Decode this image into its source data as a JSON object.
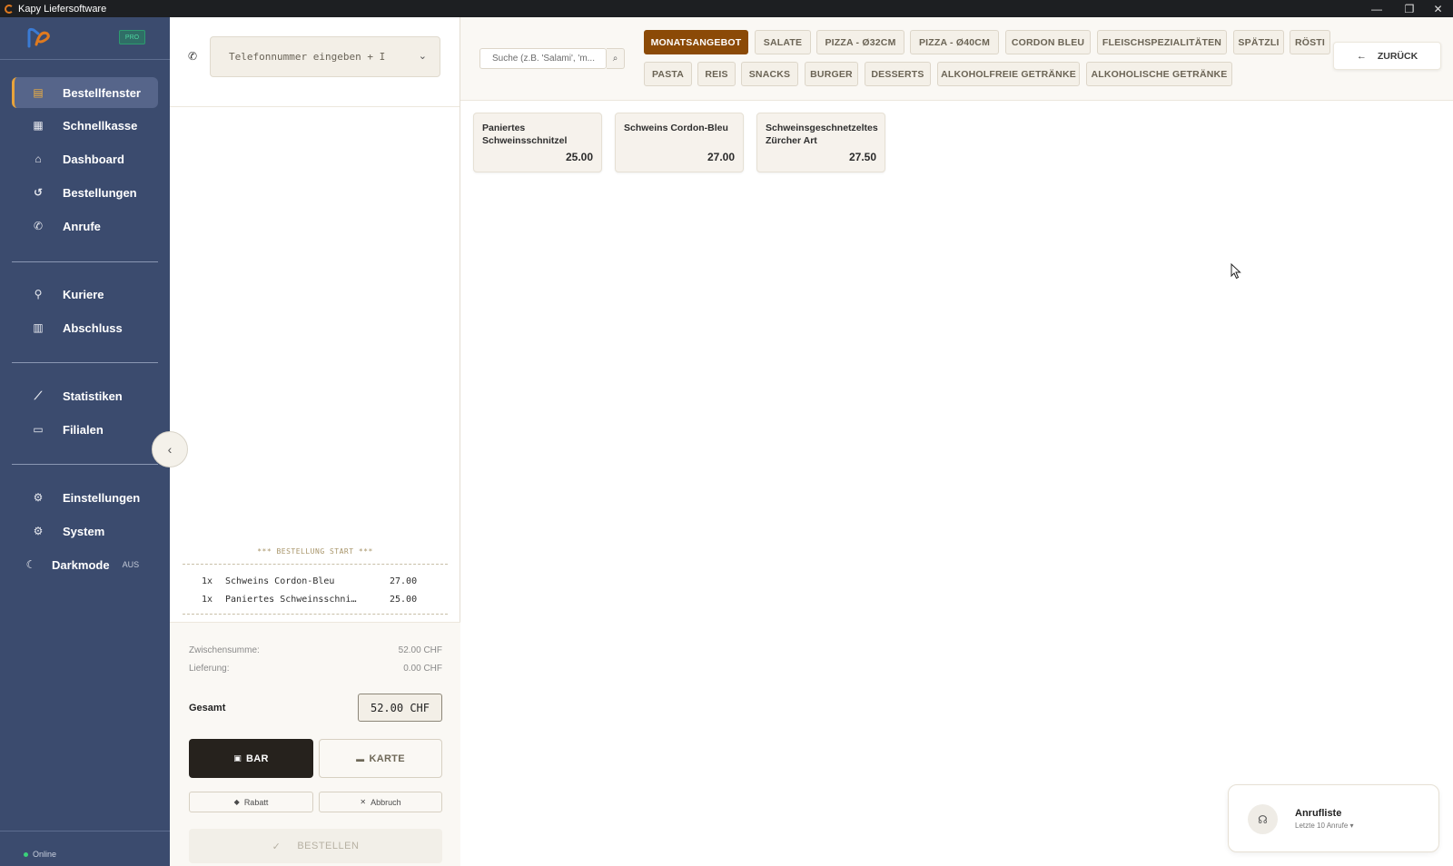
{
  "window": {
    "title": "Kapy Liefersoftware",
    "controls": {
      "minimize": "—",
      "maximize": "❐",
      "close": "✕"
    }
  },
  "sidebar": {
    "badge": "PRO",
    "items": [
      {
        "label": "Bestellfenster",
        "icon": "receipt-icon"
      },
      {
        "label": "Schnellkasse",
        "icon": "register-icon"
      },
      {
        "label": "Dashboard",
        "icon": "home-icon"
      },
      {
        "label": "Bestellungen",
        "icon": "history-icon"
      },
      {
        "label": "Anrufe",
        "icon": "phone-icon"
      },
      {
        "label": "Kuriere",
        "icon": "bicycle-icon"
      },
      {
        "label": "Abschluss",
        "icon": "document-icon"
      },
      {
        "label": "Statistiken",
        "icon": "chart-line-icon"
      },
      {
        "label": "Filialen",
        "icon": "store-icon"
      },
      {
        "label": "Einstellungen",
        "icon": "gear-icon"
      },
      {
        "label": "System",
        "icon": "gear-icon"
      },
      {
        "label": "Darkmode",
        "icon": "moon-icon",
        "state": "AUS"
      }
    ],
    "status": "Online"
  },
  "order": {
    "phone_placeholder": "Telefonnummer eingeben + I",
    "receipt_header": "*** BESTELLUNG START ***",
    "lines": [
      {
        "qty": "1x",
        "name": "Schweins Cordon-Bleu",
        "price": "27.00"
      },
      {
        "qty": "1x",
        "name": "Paniertes Schweinsschni…",
        "price": "25.00"
      }
    ],
    "subtotal_label": "Zwischensumme:",
    "subtotal_value": "52.00 CHF",
    "delivery_label": "Lieferung:",
    "delivery_value": "0.00 CHF",
    "total_label": "Gesamt",
    "total_value": "52.00 CHF",
    "pay_cash": "BAR",
    "pay_card": "KARTE",
    "discount": "Rabatt",
    "cancel": "Abbruch",
    "submit": "BESTELLEN"
  },
  "catalog": {
    "search_placeholder": "Suche (z.B. 'Salami', 'm...",
    "categories_row1": [
      "MONATSANGEBOT",
      "SALATE",
      "PIZZA - Ø32CM",
      "PIZZA - Ø40CM",
      "CORDON BLEU",
      "FLEISCHSPEZIALITÄTEN",
      "SPÄTZLI",
      "RÖSTI"
    ],
    "categories_row2": [
      "PASTA",
      "REIS",
      "SNACKS",
      "BURGER",
      "DESSERTS",
      "ALKOHOLFREIE GETRÄNKE",
      "ALKOHOLISCHE GETRÄNKE"
    ],
    "back": "ZURÜCK",
    "products": [
      {
        "name": "Paniertes Schweinsschnitzel",
        "price": "25.00"
      },
      {
        "name": "Schweins Cordon-Bleu",
        "price": "27.00"
      },
      {
        "name": "Schweinsgeschnetzeltes Zürcher Art",
        "price": "27.50"
      }
    ]
  },
  "call_list": {
    "title": "Anrufliste",
    "subtitle": "Letzte 10 Anrufe ▾"
  },
  "colors": {
    "sidebar": "#3b4b6e",
    "accent": "#8b4a07",
    "active_marker": "#e8a33b"
  }
}
